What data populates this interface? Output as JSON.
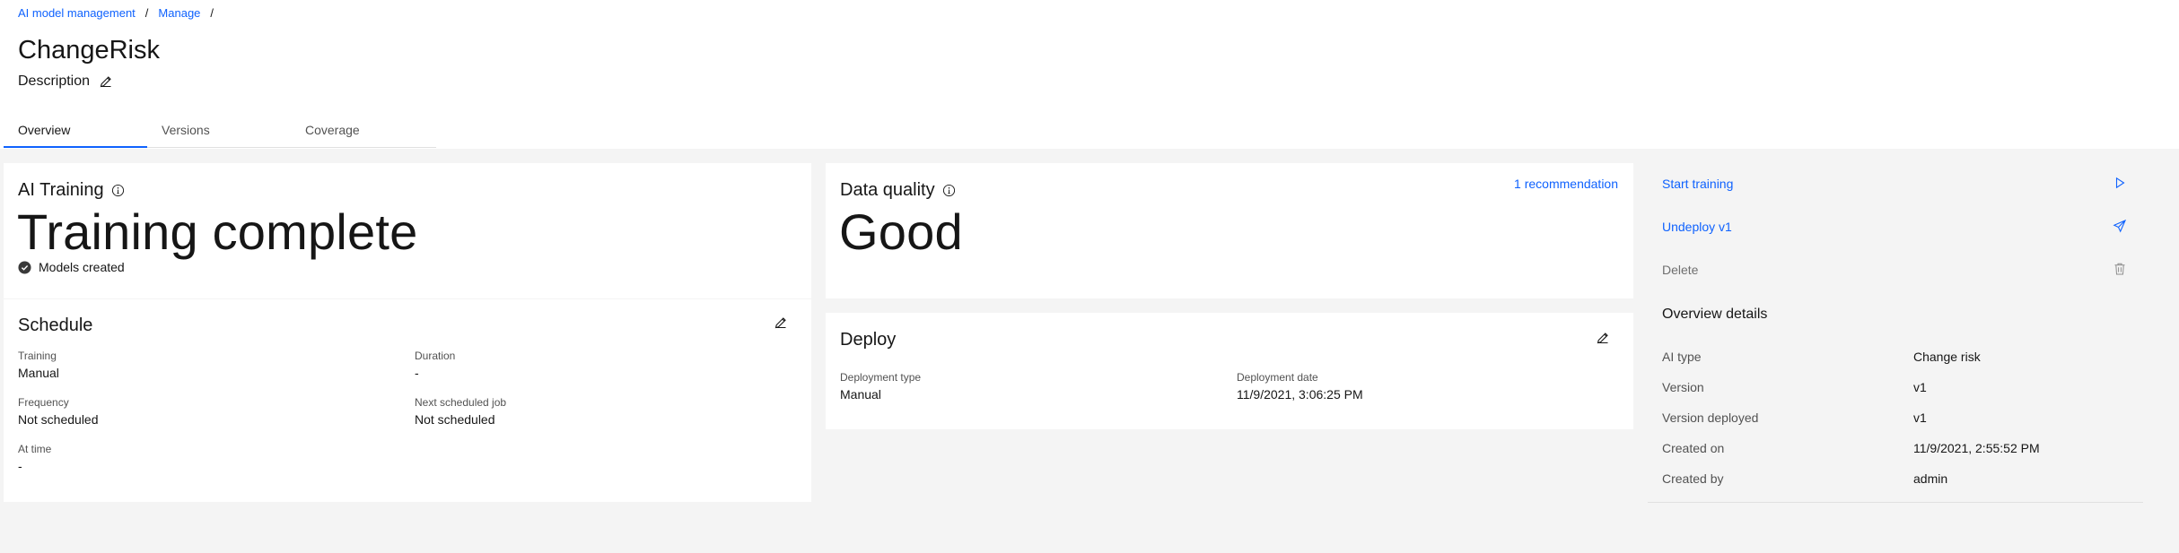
{
  "breadcrumb": {
    "item1": "AI model management",
    "item2": "Manage",
    "sep": "/"
  },
  "page": {
    "title": "ChangeRisk",
    "description_label": "Description"
  },
  "tabs": [
    {
      "label": "Overview"
    },
    {
      "label": "Versions"
    },
    {
      "label": "Coverage"
    }
  ],
  "training": {
    "title": "AI Training",
    "status": "Training complete",
    "sub_status": "Models created"
  },
  "schedule": {
    "title": "Schedule",
    "fields": [
      {
        "label": "Training",
        "value": "Manual"
      },
      {
        "label": "Duration",
        "value": "-"
      },
      {
        "label": "Frequency",
        "value": "Not scheduled"
      },
      {
        "label": "Next scheduled job",
        "value": "Not scheduled"
      },
      {
        "label": "At time",
        "value": "-"
      }
    ]
  },
  "quality": {
    "title": "Data quality",
    "status": "Good",
    "recommendation_link": "1 recommendation"
  },
  "deploy": {
    "title": "Deploy",
    "fields": [
      {
        "label": "Deployment type",
        "value": "Manual"
      },
      {
        "label": "Deployment date",
        "value": "11/9/2021, 3:06:25 PM"
      }
    ]
  },
  "actions": [
    {
      "label": "Start training",
      "icon": "play-icon"
    },
    {
      "label": "Undeploy v1",
      "icon": "send-icon"
    },
    {
      "label": "Delete",
      "icon": "trash-icon"
    }
  ],
  "overview": {
    "title": "Overview details",
    "rows": [
      {
        "key": "AI type",
        "value": "Change risk"
      },
      {
        "key": "Version",
        "value": "v1"
      },
      {
        "key": "Version deployed",
        "value": "v1"
      },
      {
        "key": "Created on",
        "value": "11/9/2021, 2:55:52 PM"
      },
      {
        "key": "Created by",
        "value": "admin"
      }
    ]
  },
  "colors": {
    "link": "#0f62fe",
    "background": "#f4f4f4",
    "card": "#ffffff",
    "text": "#161616",
    "muted": "#525252",
    "disabled": "#8d8d8d"
  }
}
